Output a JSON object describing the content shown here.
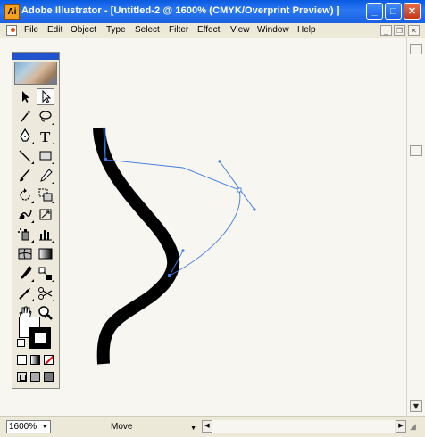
{
  "window": {
    "title": "Adobe Illustrator - [Untitled-2 @ 1600% (CMYK/Overprint Preview) ]",
    "buttons": {
      "minimize": "_",
      "maximize": "□",
      "close": "✕"
    }
  },
  "menubar": {
    "items": [
      "File",
      "Edit",
      "Object",
      "Type",
      "Select",
      "Filter",
      "Effect",
      "View",
      "Window",
      "Help"
    ],
    "doc_buttons": {
      "minimize": "_",
      "restore": "❐",
      "close": "✕"
    }
  },
  "toolbox": {
    "tools": [
      {
        "name": "selection-tool",
        "icon": "arrow-icon"
      },
      {
        "name": "direct-selection-tool",
        "icon": "hollow-arrow-icon"
      },
      {
        "name": "magic-wand-tool",
        "icon": "magic-wand-icon"
      },
      {
        "name": "lasso-tool",
        "icon": "lasso-icon"
      },
      {
        "name": "pen-tool",
        "icon": "pen-icon"
      },
      {
        "name": "type-tool",
        "icon": "type-icon"
      },
      {
        "name": "line-segment-tool",
        "icon": "line-icon"
      },
      {
        "name": "rectangle-tool",
        "icon": "rectangle-icon"
      },
      {
        "name": "paintbrush-tool",
        "icon": "brush-icon"
      },
      {
        "name": "pencil-tool",
        "icon": "pencil-icon"
      },
      {
        "name": "rotate-tool",
        "icon": "rotate-icon"
      },
      {
        "name": "scale-tool",
        "icon": "scale-icon"
      },
      {
        "name": "warp-tool",
        "icon": "warp-icon"
      },
      {
        "name": "free-transform-tool",
        "icon": "free-transform-icon"
      },
      {
        "name": "symbol-sprayer-tool",
        "icon": "symbol-sprayer-icon"
      },
      {
        "name": "column-graph-tool",
        "icon": "graph-icon"
      },
      {
        "name": "mesh-tool",
        "icon": "mesh-icon"
      },
      {
        "name": "gradient-tool",
        "icon": "gradient-icon"
      },
      {
        "name": "eyedropper-tool",
        "icon": "eyedropper-icon"
      },
      {
        "name": "blend-tool",
        "icon": "blend-icon"
      },
      {
        "name": "slice-tool",
        "icon": "slice-icon"
      },
      {
        "name": "scissors-tool",
        "icon": "scissors-icon"
      },
      {
        "name": "hand-tool",
        "icon": "hand-icon"
      },
      {
        "name": "zoom-tool",
        "icon": "zoom-icon"
      }
    ],
    "modes": [
      "color-mode",
      "gradient-mode",
      "none-mode"
    ],
    "screen_modes": [
      "standard-screen",
      "full-screen-menu",
      "full-screen"
    ]
  },
  "statusbar": {
    "zoom": "1600%",
    "mode": "Move"
  }
}
